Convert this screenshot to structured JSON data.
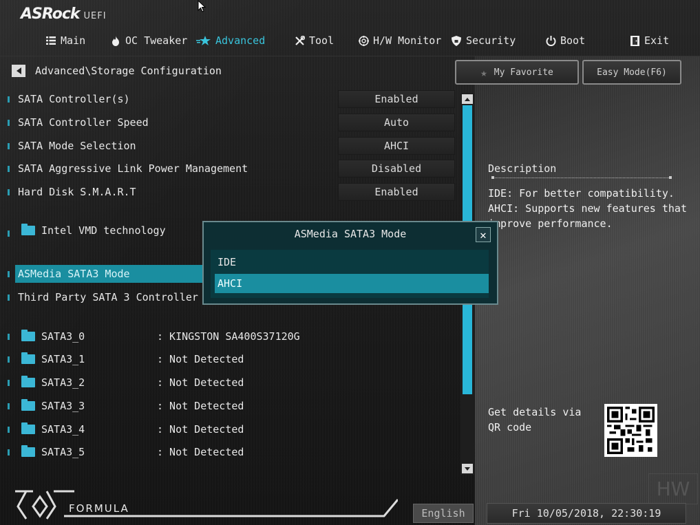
{
  "header": {
    "brand": "ASRock",
    "brand_suffix": "UEFI"
  },
  "nav": [
    {
      "label": "Main",
      "icon": "menu-icon",
      "active": false
    },
    {
      "label": "OC Tweaker",
      "icon": "flame-icon",
      "active": false
    },
    {
      "label": "Advanced",
      "icon": "star-icon",
      "active": true
    },
    {
      "label": "Tool",
      "icon": "tools-icon",
      "active": false
    },
    {
      "label": "H/W Monitor",
      "icon": "monitor-icon",
      "active": false
    },
    {
      "label": "Security",
      "icon": "shield-icon",
      "active": false
    },
    {
      "label": "Boot",
      "icon": "power-icon",
      "active": false
    },
    {
      "label": "Exit",
      "icon": "exit-icon",
      "active": false
    }
  ],
  "breadcrumb": "Advanced\\Storage Configuration",
  "buttons": {
    "favorite": "My Favorite",
    "easy_mode": "Easy Mode(F6)"
  },
  "settings": [
    {
      "label": "SATA Controller(s)",
      "value": "Enabled"
    },
    {
      "label": "SATA Controller Speed",
      "value": "Auto"
    },
    {
      "label": "SATA Mode Selection",
      "value": "AHCI"
    },
    {
      "label": "SATA Aggressive Link Power Management",
      "value": "Disabled"
    },
    {
      "label": "Hard Disk S.M.A.R.T",
      "value": "Enabled"
    }
  ],
  "submenu_vmd": "Intel VMD technology",
  "asmedia_row": "ASMedia SATA3 Mode",
  "third_party_row": "Third Party SATA 3 Controller",
  "ports": [
    {
      "name": "SATA3_0",
      "device": ": KINGSTON SA400S37120G"
    },
    {
      "name": "SATA3_1",
      "device": ": Not Detected"
    },
    {
      "name": "SATA3_2",
      "device": ": Not Detected"
    },
    {
      "name": "SATA3_3",
      "device": ": Not Detected"
    },
    {
      "name": "SATA3_4",
      "device": ": Not Detected"
    },
    {
      "name": "SATA3_5",
      "device": ": Not Detected"
    }
  ],
  "description": {
    "title": "Description",
    "text": "IDE: For better compatibility. AHCI: Supports new features that improve performance.",
    "qr_text": "Get details via QR code"
  },
  "modal": {
    "title": "ASMedia SATA3 Mode",
    "options": [
      "IDE",
      "AHCI"
    ],
    "selected": "AHCI"
  },
  "footer": {
    "formula": "FORMULA",
    "language": "English",
    "datetime": "Fri 10/05/2018, 22:30:19"
  },
  "watermark": "HW",
  "colors": {
    "accent": "#39c4dc",
    "selection": "#1a8ea0",
    "folder": "#3bb7d6"
  }
}
